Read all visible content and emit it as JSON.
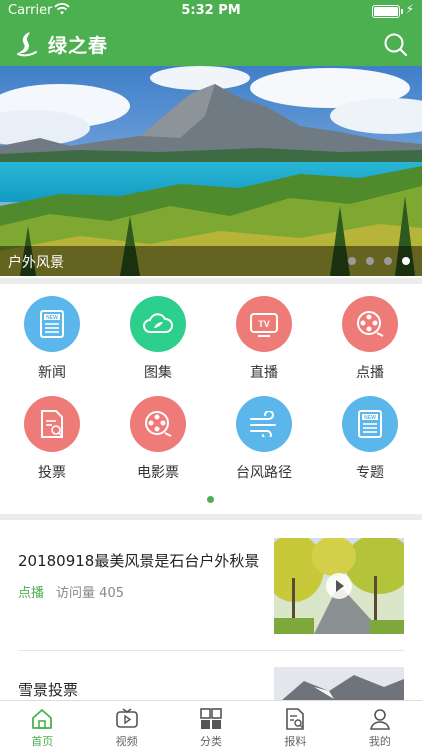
{
  "status_bar": {
    "carrier": "Carrier",
    "time": "5:32 PM"
  },
  "app": {
    "title": "绿之春"
  },
  "colors": {
    "brand": "#4caf50",
    "blue": "#5bb6ec",
    "green": "#2dcf8c",
    "red": "#ef7b79"
  },
  "banner": {
    "caption": "户外风景",
    "dot_count": 4,
    "active_dot": 4
  },
  "categories": [
    {
      "label": "新闻",
      "icon": "news-icon",
      "color": "blue"
    },
    {
      "label": "图集",
      "icon": "gallery-icon",
      "color": "green"
    },
    {
      "label": "直播",
      "icon": "tv-icon",
      "color": "red"
    },
    {
      "label": "点播",
      "icon": "film-reel-icon",
      "color": "red"
    },
    {
      "label": "投票",
      "icon": "vote-icon",
      "color": "red"
    },
    {
      "label": "电影票",
      "icon": "movie-ticket-icon",
      "color": "red"
    },
    {
      "label": "台风路径",
      "icon": "wind-icon",
      "color": "blue"
    },
    {
      "label": "专题",
      "icon": "topic-icon",
      "color": "blue"
    }
  ],
  "news": [
    {
      "title": "20180918最美风景是石台户外秋景",
      "tag": "点播",
      "views_label": "访问量",
      "views": "405"
    },
    {
      "title": "雪景投票"
    }
  ],
  "tabs": [
    {
      "label": "首页",
      "icon": "home-icon",
      "active": true
    },
    {
      "label": "视频",
      "icon": "video-icon",
      "active": false
    },
    {
      "label": "分类",
      "icon": "category-icon",
      "active": false
    },
    {
      "label": "报料",
      "icon": "report-icon",
      "active": false
    },
    {
      "label": "我的",
      "icon": "user-icon",
      "active": false
    }
  ]
}
